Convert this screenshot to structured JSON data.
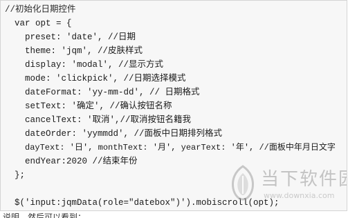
{
  "code": {
    "lines": [
      "//初始化日期控件",
      "var opt = {",
      "preset: 'date', //日期",
      "theme: 'jqm', //皮肤样式",
      "display: 'modal', //显示方式",
      "mode: 'clickpick', //日期选择模式",
      "dateFormat: 'yy-mm-dd', // 日期格式",
      "setText: '确定', //确认按钮名称",
      "cancelText: '取消',//取消按钮名籍我",
      "dateOrder: 'yymmdd', //面板中日期排列格式",
      "dayText: '日', monthText: '月', yearText: '年', //面板中年月日文字",
      "endYear:2020 //结束年份",
      "};",
      "$('input:jqmData(role=\"datebox\")').mobiscroll(opt);"
    ]
  },
  "watermark": {
    "title": "当下软件园",
    "url": "www.downxia.com",
    "logo_icon": "leaf-shield-logo-icon"
  },
  "footer": {
    "text": "说明，然后可以看到："
  }
}
